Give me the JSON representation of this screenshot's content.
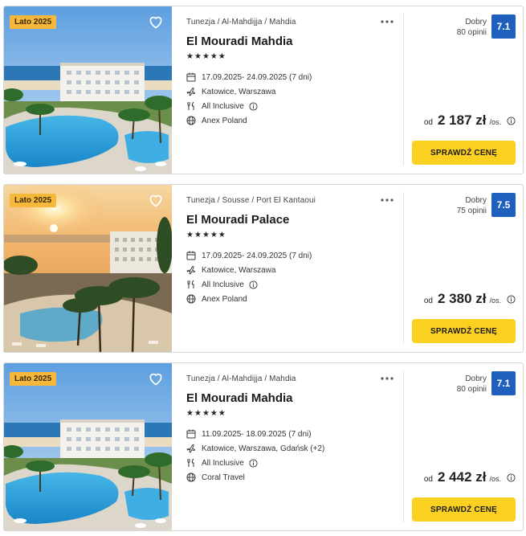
{
  "offers": [
    {
      "badge": "Lato 2025",
      "location": "Tunezja / Al-Mahdijja / Mahdia",
      "name": "El Mouradi Mahdia",
      "stars": 5,
      "dates": "17.09.2025- 24.09.2025  (7 dni)",
      "departure": "Katowice, Warszawa",
      "board": "All Inclusive",
      "operator": "Anex Poland",
      "rating_label": "Dobry",
      "reviews": "80 opinii",
      "score": "7.1",
      "price_prefix": "od",
      "price": "2 187 zł",
      "price_unit": "/os.",
      "cta": "SPRAWDŹ CENĘ",
      "scene": "pool"
    },
    {
      "badge": "Lato 2025",
      "location": "Tunezja / Sousse / Port El Kantaoui",
      "name": "El Mouradi Palace",
      "stars": 5,
      "dates": "17.09.2025- 24.09.2025  (7 dni)",
      "departure": "Katowice, Warszawa",
      "board": "All Inclusive",
      "operator": "Anex Poland",
      "rating_label": "Dobry",
      "reviews": "75 opinii",
      "score": "7.5",
      "price_prefix": "od",
      "price": "2 380 zł",
      "price_unit": "/os.",
      "cta": "SPRAWDŹ CENĘ",
      "scene": "sunset"
    },
    {
      "badge": "Lato 2025",
      "location": "Tunezja / Al-Mahdijja / Mahdia",
      "name": "El Mouradi Mahdia",
      "stars": 5,
      "dates": "11.09.2025- 18.09.2025  (7 dni)",
      "departure": "Katowice, Warszawa, Gdańsk  (+2)",
      "board": "All Inclusive",
      "operator": "Coral Travel",
      "rating_label": "Dobry",
      "reviews": "80 opinii",
      "score": "7.1",
      "price_prefix": "od",
      "price": "2 442 zł",
      "price_unit": "/os.",
      "cta": "SPRAWDŹ CENĘ",
      "scene": "pool"
    }
  ],
  "icons": {
    "favorite": "heart-icon",
    "more": "more-dots-icon",
    "dates": "calendar-icon",
    "departure": "plane-icon",
    "board": "cutlery-icon",
    "board_info": "info-icon",
    "operator": "globe-icon",
    "price_info": "info-icon"
  },
  "colors": {
    "badge": "#f7b73b",
    "score_bg": "#1f5fbe",
    "cta_bg": "#fcd021"
  }
}
